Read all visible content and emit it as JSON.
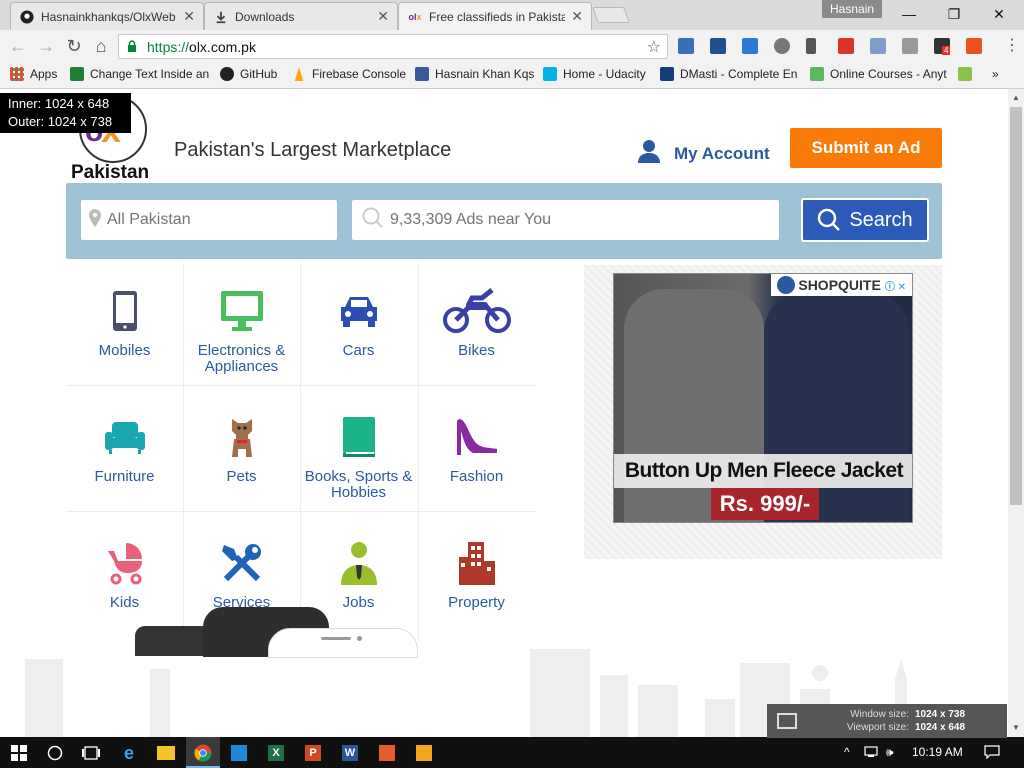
{
  "browser": {
    "tabs": [
      {
        "title": "Hasnainkhankqs/OlxWeb",
        "active": false
      },
      {
        "title": "Downloads",
        "active": false
      },
      {
        "title": "Free classifieds in Pakista",
        "active": true
      }
    ],
    "profile_name": "Hasnain",
    "url_scheme": "https://",
    "url_host": "olx.com.pk",
    "bookmarks": [
      {
        "label": "Apps",
        "icon": "apps-grid-icon"
      },
      {
        "label": "Change Text Inside an",
        "icon": "green-doc-icon"
      },
      {
        "label": "GitHub",
        "icon": "github-icon"
      },
      {
        "label": "Firebase Console",
        "icon": "firebase-icon"
      },
      {
        "label": "Hasnain Khan Kqs",
        "icon": "facebook-icon"
      },
      {
        "label": "Home - Udacity",
        "icon": "udacity-icon"
      },
      {
        "label": "DMasti - Complete En",
        "icon": "net-icon"
      },
      {
        "label": "Online Courses - Anyt",
        "icon": "udemy-icon"
      }
    ],
    "extension_badge": "4"
  },
  "overlay": {
    "inner": "Inner: 1024 x 648",
    "outer": "Outer: 1024 x 738"
  },
  "site": {
    "logo_country": "Pakistan",
    "tagline": "Pakistan's Largest Marketplace",
    "my_account": "My Account",
    "submit_ad": "Submit an Ad",
    "location_placeholder": "All Pakistan",
    "search_placeholder": "9,33,309 Ads near You",
    "search_button": "Search",
    "categories": [
      {
        "label": "Mobiles",
        "icon": "mobile-phone-icon",
        "color": "#4a4f6a"
      },
      {
        "label": "Electronics & Appliances",
        "icon": "monitor-icon",
        "color": "#4bbf5f"
      },
      {
        "label": "Cars",
        "icon": "car-icon",
        "color": "#2a4fb0"
      },
      {
        "label": "Bikes",
        "icon": "motorbike-icon",
        "color": "#3b3fa8"
      },
      {
        "label": "Furniture",
        "icon": "sofa-icon",
        "color": "#1aa6b0"
      },
      {
        "label": "Pets",
        "icon": "dog-icon",
        "color": "#a0704a"
      },
      {
        "label": "Books, Sports & Hobbies",
        "icon": "book-icon",
        "color": "#1ab38a"
      },
      {
        "label": "Fashion",
        "icon": "high-heel-icon",
        "color": "#8a2aa0"
      },
      {
        "label": "Kids",
        "icon": "stroller-icon",
        "color": "#e8607a"
      },
      {
        "label": "Services",
        "icon": "tools-icon",
        "color": "#1f63b8"
      },
      {
        "label": "Jobs",
        "icon": "worker-icon",
        "color": "#9abf2a"
      },
      {
        "label": "Property",
        "icon": "building-icon",
        "color": "#b0382a"
      }
    ],
    "ad": {
      "brand": "SHOPQUITE",
      "headline": "Button Up Men Fleece Jacket",
      "price": "Rs. 999/-"
    }
  },
  "window_size": {
    "window_label": "Window size:",
    "window_value": "1024 x 738",
    "viewport_label": "Viewport size:",
    "viewport_value": "1024 x 648"
  },
  "taskbar": {
    "time": "10:19 AM"
  }
}
